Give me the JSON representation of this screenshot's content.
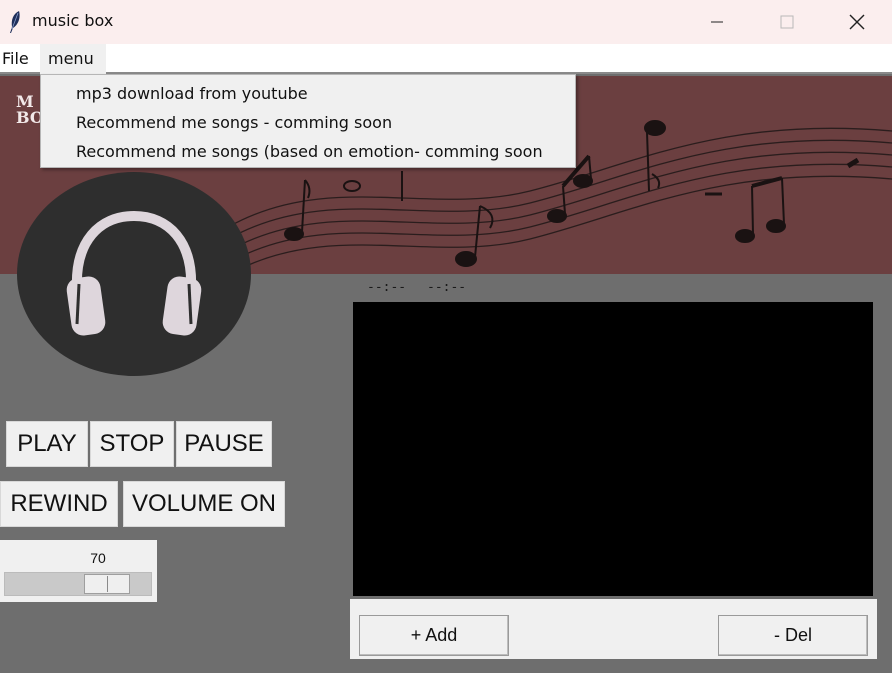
{
  "window": {
    "title": "music box",
    "icon": "feather-icon",
    "controls": [
      "minimize-icon",
      "maximize-icon",
      "close-icon"
    ]
  },
  "menubar": {
    "items": [
      "File",
      "menu"
    ]
  },
  "dropdown": {
    "open_menu": "menu",
    "items": [
      "mp3 download from youtube",
      "Recommend me songs - comming soon",
      "Recommend me songs (based on emotion- comming soon"
    ]
  },
  "banner": {
    "logo_lines": [
      "M",
      "BO"
    ],
    "background_color": "#6b3f40"
  },
  "avatar": {
    "icon": "headphones-icon"
  },
  "controls": {
    "play": "PLAY",
    "stop": "STOP",
    "pause": "PAUSE",
    "rewind": "REWIND",
    "volume": "VOLUME ON"
  },
  "volume_scale": {
    "value": "70",
    "fraction": 0.7
  },
  "time": {
    "current": "--:--",
    "total": "--:--"
  },
  "playlist": {
    "items": [],
    "add_label": "+ Add",
    "del_label": "- Del"
  }
}
